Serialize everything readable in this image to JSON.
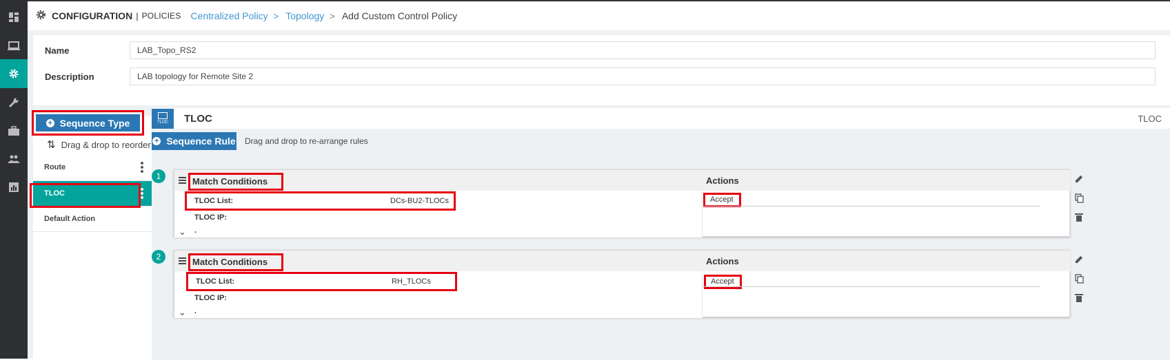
{
  "nav": {
    "items": [
      {
        "name": "dashboard-icon"
      },
      {
        "name": "monitor-icon"
      },
      {
        "name": "configuration-icon",
        "active": true
      },
      {
        "name": "tools-icon"
      },
      {
        "name": "maintenance-icon"
      },
      {
        "name": "administration-icon"
      },
      {
        "name": "analytics-icon"
      }
    ]
  },
  "header": {
    "section": "CONFIGURATION",
    "separator": "|",
    "subsection": "POLICIES",
    "breadcrumbs": [
      "Centralized Policy",
      "Topology"
    ],
    "breadcrumb_sep": ">",
    "current": "Add Custom Control Policy"
  },
  "form": {
    "name_label": "Name",
    "name_value": "LAB_Topo_RS2",
    "description_label": "Description",
    "description_value": "LAB topology for Remote Site 2"
  },
  "sidebar": {
    "sequence_type_label": "Sequence Type",
    "drag_reorder_label": "Drag & drop to reorder",
    "items": [
      {
        "label": "Route"
      },
      {
        "label": "TLOC",
        "active": true
      },
      {
        "label": "Default Action"
      }
    ]
  },
  "panel": {
    "icon_text": "TLOC",
    "title": "TLOC",
    "right_title": "TLOC",
    "sequence_rule_label": "Sequence Rule",
    "drag_rules_hint": "Drag and drop to re-arrange rules"
  },
  "rules": [
    {
      "number": "1",
      "match_title": "Match Conditions",
      "actions_title": "Actions",
      "tloc_list_label": "TLOC List:",
      "tloc_list_value": "DCs-BU2-TLOCs",
      "tloc_ip_label": "TLOC IP:",
      "action_value": "Accept"
    },
    {
      "number": "2",
      "match_title": "Match Conditions",
      "actions_title": "Actions",
      "tloc_list_label": "TLOC List:",
      "tloc_list_value": "RH_TLOCs",
      "tloc_ip_label": "TLOC IP:",
      "action_value": "Accept"
    }
  ],
  "colors": {
    "accent_teal": "#02a49b",
    "primary_blue": "#2b77b4",
    "link_blue": "#3e97d2",
    "highlight_red": "#e60012",
    "nav_bg": "#2e2f33"
  }
}
